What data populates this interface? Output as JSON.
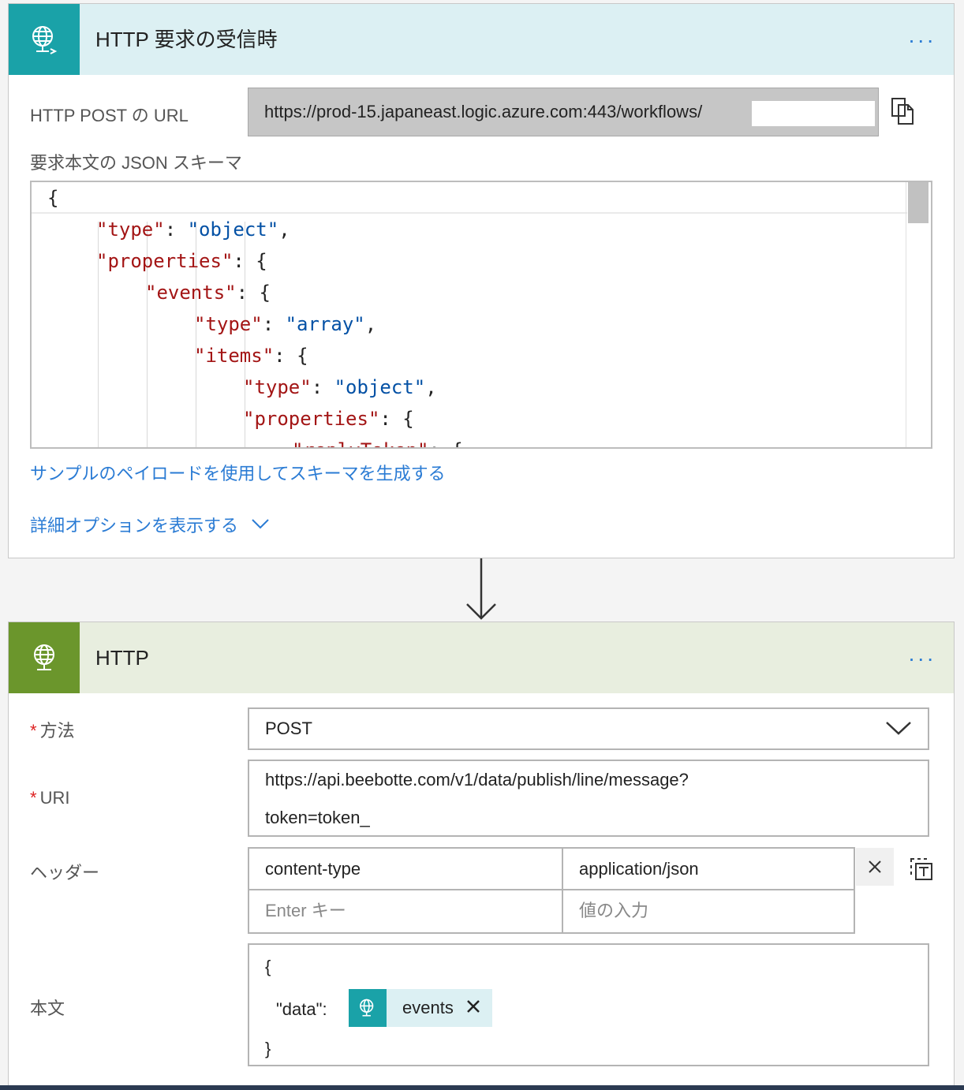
{
  "trigger": {
    "title": "HTTP 要求の受信時",
    "menu": "...",
    "url_label": "HTTP POST の URL",
    "url_value": "https://prod-15.japaneast.logic.azure.com:443/workflows/",
    "schema_label": "要求本文の JSON スキーマ",
    "schema_lines": [
      "{",
      "\"type\": \"object\",",
      "\"properties\": {",
      "\"events\": {",
      "\"type\": \"array\",",
      "\"items\": {",
      "\"type\": \"object\",",
      "\"properties\": {",
      "\"replyToken\": {"
    ],
    "sample_link": "サンプルのペイロードを使用してスキーマを生成する",
    "advanced_link": "詳細オプションを表示する"
  },
  "http_action": {
    "title": "HTTP",
    "menu": "...",
    "required_mark": "*",
    "method_label": "方法",
    "method_value": "POST",
    "uri_label": "URI",
    "uri_value_line1": "https://api.beebotte.com/v1/data/publish/line/message?",
    "uri_value_line2": "token=token_",
    "headers_label": "ヘッダー",
    "header_key": "content-type",
    "header_value": "application/json",
    "header_key_placeholder": "Enter キー",
    "header_value_placeholder": "値の入力",
    "body_label": "本文",
    "body_open": "{",
    "body_key": "\"data\":",
    "body_token": "events",
    "body_close": "}"
  },
  "colors": {
    "trigger_accent": "#1aa2a8",
    "http_accent": "#6b962c",
    "link": "#2a7bd4",
    "required": "#dd2222"
  }
}
